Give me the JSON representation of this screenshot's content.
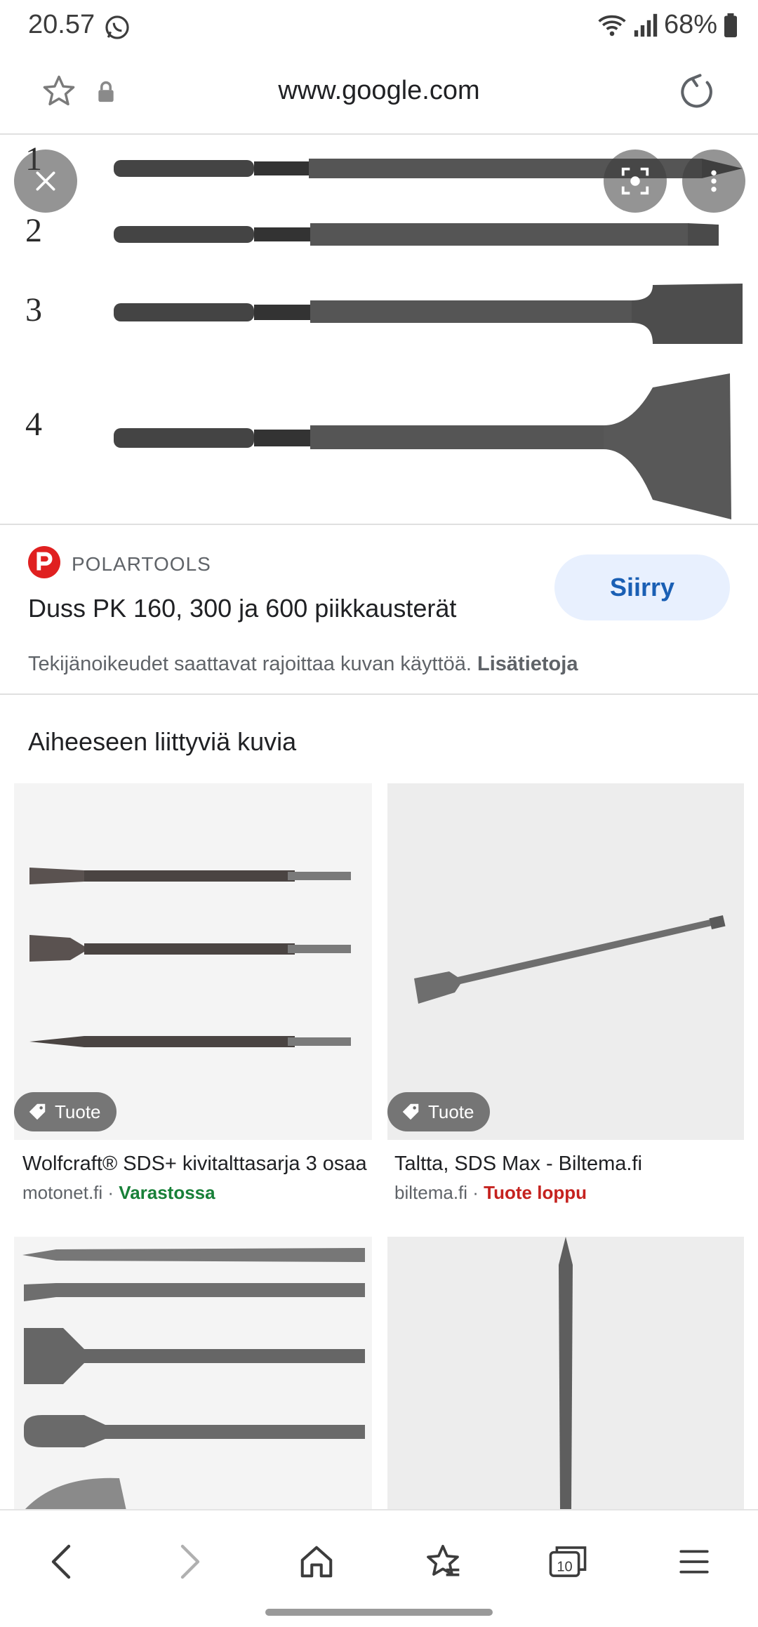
{
  "status_bar": {
    "time": "20.57",
    "battery": "68%"
  },
  "browser": {
    "url": "www.google.com"
  },
  "result": {
    "source": "POLARTOOLS",
    "title": "Duss PK 160, 300 ja 600 piikkausterät",
    "go_label": "Siirry",
    "copyright_text": "Tekijänoikeudet saattavat rajoittaa kuvan käyttöä.",
    "copyright_link": "Lisätietoja",
    "hero_labels": [
      "1",
      "2",
      "3",
      "4"
    ]
  },
  "related": {
    "heading": "Aiheeseen liittyviä kuvia",
    "items": [
      {
        "badge": "Tuote",
        "title": "Wolfcraft® SDS+ kivitalttasarja 3 osaa",
        "domain": "motonet.fi",
        "separator": " · ",
        "status": "Varastossa",
        "status_color": "#188038"
      },
      {
        "badge": "Tuote",
        "title": "Taltta, SDS Max - Biltema.fi",
        "domain": "biltema.fi",
        "separator": " · ",
        "status": "Tuote loppu",
        "status_color": "#c5221f"
      }
    ]
  },
  "colors": {
    "accent": "#1a5fb4",
    "go_button_bg": "#e8f0fe"
  },
  "icons": [
    "whatsapp-icon",
    "wifi-icon",
    "signal-icon",
    "battery-icon",
    "star-icon",
    "lock-icon",
    "reload-icon",
    "close-icon",
    "lens-icon",
    "more-vert-icon",
    "tag-icon",
    "back-icon",
    "forward-icon",
    "home-icon",
    "bookmarks-icon",
    "tabs-icon",
    "menu-icon"
  ]
}
